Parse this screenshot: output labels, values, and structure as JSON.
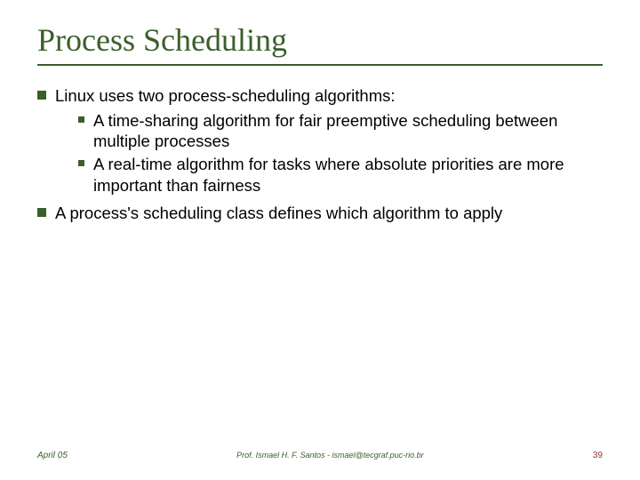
{
  "title": "Process Scheduling",
  "bullets": {
    "b1": "Linux uses two process-scheduling algorithms:",
    "b1_sub1": "A time-sharing algorithm for fair preemptive scheduling between multiple processes",
    "b1_sub2": "A real-time algorithm for tasks where absolute priorities are more important than fairness",
    "b2": "A process's scheduling class defines which algorithm to apply"
  },
  "footer": {
    "date": "April 05",
    "author": "Prof. Ismael H. F. Santos  -  ismael@tecgraf.puc-rio.br",
    "page": "39"
  }
}
